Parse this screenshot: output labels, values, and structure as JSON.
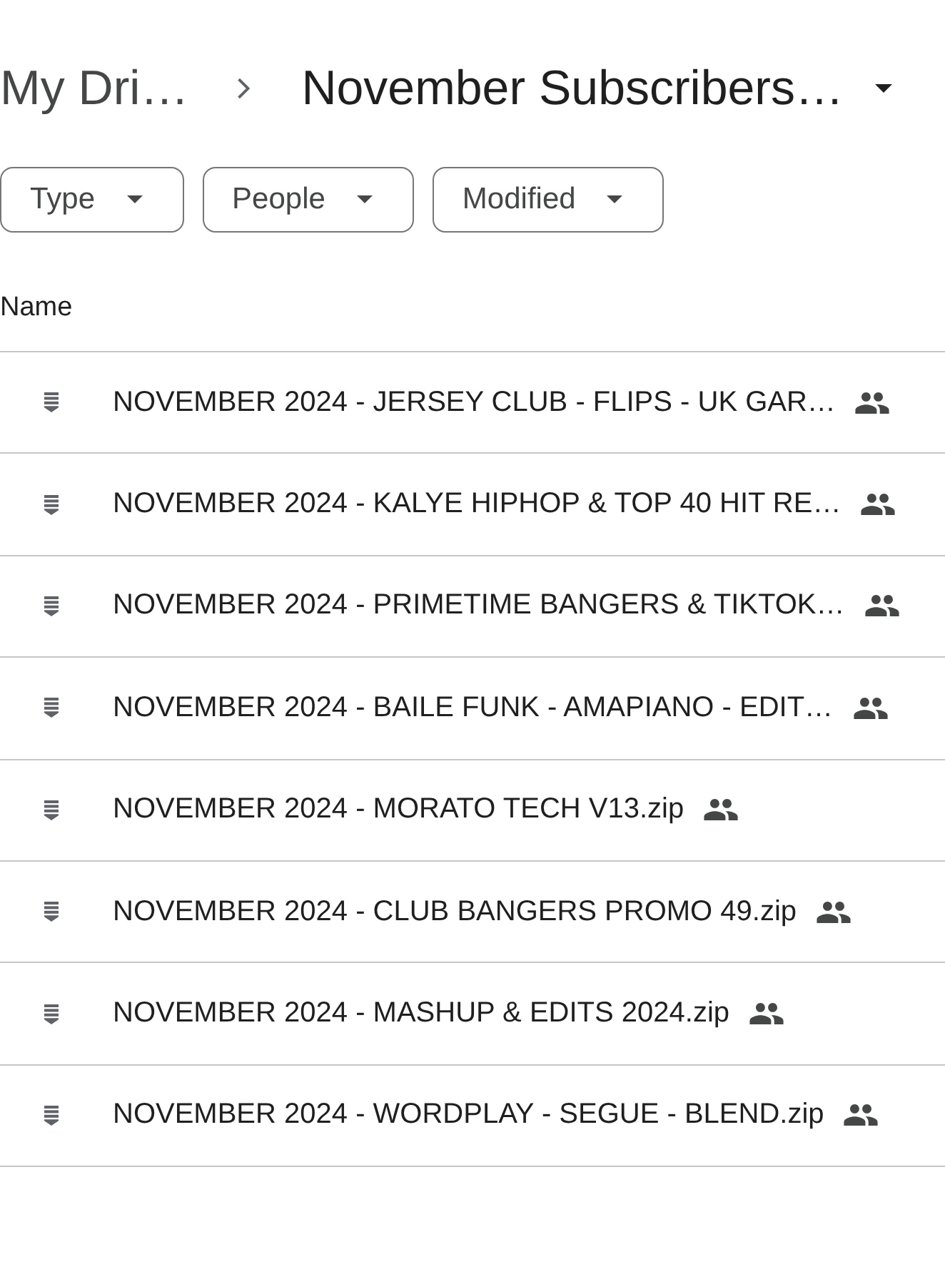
{
  "breadcrumb": [
    {
      "label": "My Dri…",
      "dropdown": false
    },
    {
      "label": "November Subscribers…",
      "dropdown": true
    }
  ],
  "filters": [
    {
      "label": "Type"
    },
    {
      "label": "People"
    },
    {
      "label": "Modified"
    }
  ],
  "table": {
    "columns": [
      "Name"
    ],
    "rows": [
      {
        "name": "NOVEMBER 2024 - JERSEY CLUB - FLIPS - UK GAR…",
        "shared": true
      },
      {
        "name": "NOVEMBER 2024 - KALYE HIPHOP & TOP 40 HIT RE…",
        "shared": true
      },
      {
        "name": "NOVEMBER 2024 - PRIMETIME BANGERS & TIKTOK…",
        "shared": true
      },
      {
        "name": "NOVEMBER 2024 - BAILE FUNK - AMAPIANO - EDIT…",
        "shared": true
      },
      {
        "name": "NOVEMBER 2024 - MORATO TECH V13.zip",
        "shared": true
      },
      {
        "name": "NOVEMBER 2024 - CLUB BANGERS PROMO 49.zip",
        "shared": true
      },
      {
        "name": "NOVEMBER 2024 - MASHUP & EDITS 2024.zip",
        "shared": true
      },
      {
        "name": "NOVEMBER 2024 - WORDPLAY - SEGUE - BLEND.zip",
        "shared": true
      }
    ]
  }
}
